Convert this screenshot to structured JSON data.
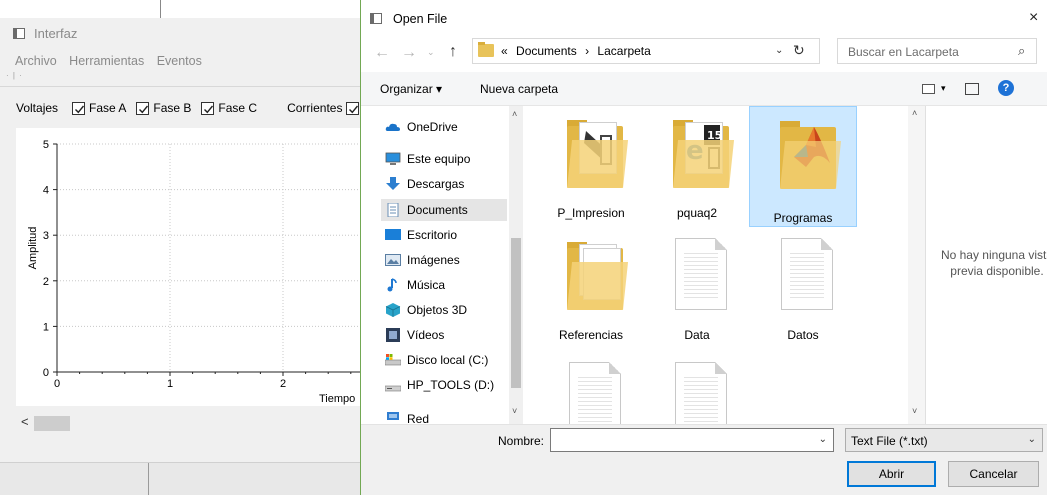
{
  "background_app": {
    "title": "Interfaz",
    "menu": [
      "Archivo",
      "Herramientas",
      "Eventos"
    ],
    "toolbar_tiny": "· | ·",
    "voltages_label": "Voltajes",
    "voltage_checks": [
      "Fase A",
      "Fase B",
      "Fase C"
    ],
    "currents_label": "Corrientes",
    "chart": {
      "ylabel": "Amplitud",
      "xlabel": "Tiempo",
      "y_ticks": [
        "0",
        "1",
        "2",
        "3",
        "4",
        "5"
      ],
      "x_ticks": [
        "0",
        "1",
        "2"
      ]
    },
    "scroll_left": "<"
  },
  "dialog": {
    "title": "Open File",
    "close": "×",
    "nav_back": "←",
    "nav_forward": "→",
    "nav_recent": "⌄",
    "nav_up": "↑",
    "address": {
      "prefix": "«",
      "crumbs": [
        "Documents",
        "›",
        "Lacarpeta"
      ],
      "dropdown": "⌄",
      "refresh": "↻"
    },
    "search_placeholder": "Buscar en Lacarpeta",
    "search_icon": "⌕",
    "commands": {
      "organize": "Organizar ▾",
      "new_folder": "Nueva carpeta",
      "view_caret": "▾",
      "help": "?"
    },
    "nav_pane": [
      {
        "label": "OneDrive",
        "icon": "cloud-icon"
      },
      {
        "label": "Este equipo",
        "icon": "computer-icon"
      },
      {
        "label": "Descargas",
        "icon": "download-icon"
      },
      {
        "label": "Documents",
        "icon": "documents-icon",
        "selected": true
      },
      {
        "label": "Escritorio",
        "icon": "desktop-icon"
      },
      {
        "label": "Imágenes",
        "icon": "pictures-icon"
      },
      {
        "label": "Música",
        "icon": "music-icon"
      },
      {
        "label": "Objetos 3D",
        "icon": "3d-objects-icon"
      },
      {
        "label": "Vídeos",
        "icon": "videos-icon"
      },
      {
        "label": "Disco local (C:)",
        "icon": "drive-icon"
      },
      {
        "label": "HP_TOOLS (D:)",
        "icon": "usb-drive-icon"
      },
      {
        "label": "Red",
        "icon": "network-icon"
      }
    ],
    "files": [
      {
        "label": "P_Impresion",
        "kind": "folder"
      },
      {
        "label": "pquaq2",
        "kind": "folder"
      },
      {
        "label": "Programas",
        "kind": "folder",
        "selected": true
      },
      {
        "label": "Referencias",
        "kind": "folder"
      },
      {
        "label": "Data",
        "kind": "file"
      },
      {
        "label": "Datos",
        "kind": "file"
      }
    ],
    "preview_message": "No hay ninguna vista previa disponible.",
    "filename_label": "Nombre:",
    "filename_value": "",
    "filetype": "Text File (*.txt)",
    "open_button": "Abrir",
    "cancel_button": "Cancelar",
    "scroll_up": "˄",
    "scroll_down": "˅",
    "dropdown_caret": "⌄"
  }
}
